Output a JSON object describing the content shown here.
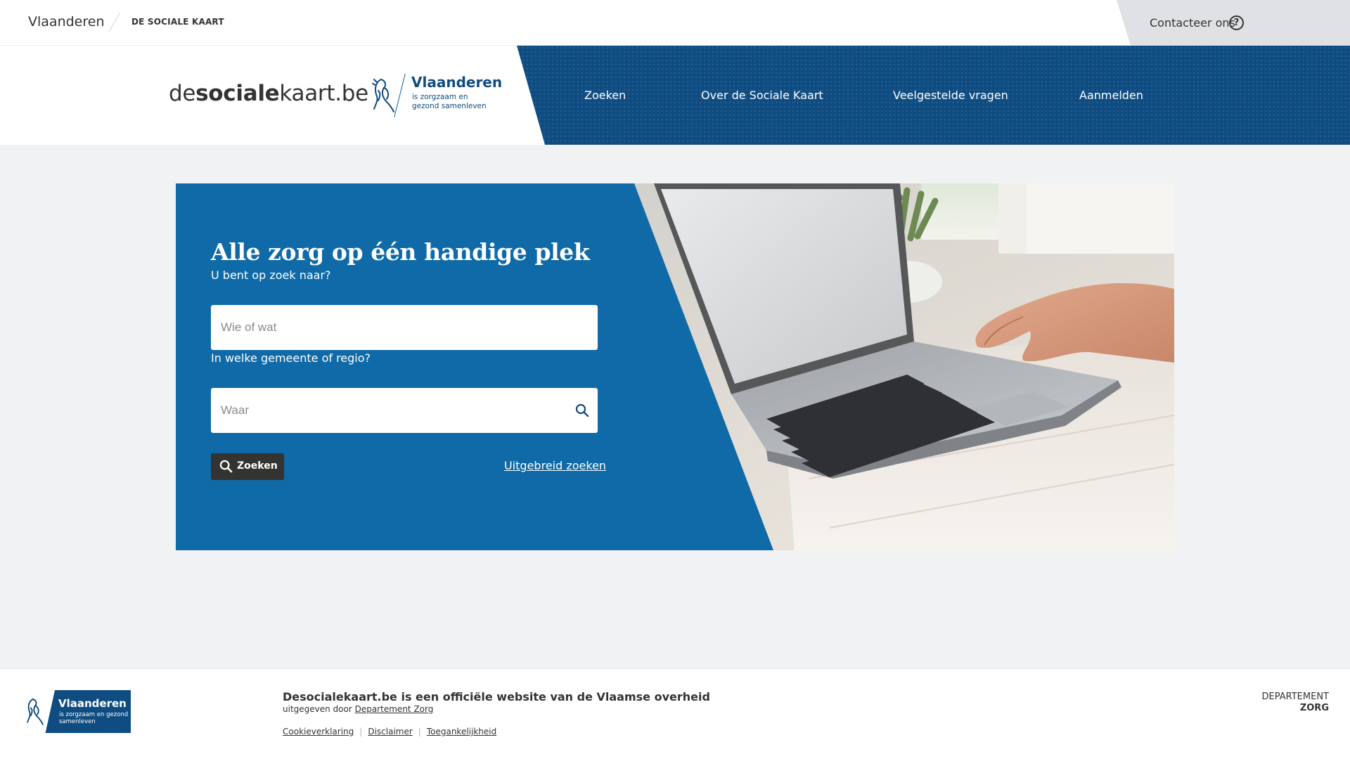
{
  "topbar": {
    "brand": "Vlaanderen",
    "site_name": "DE SOCIALE KAART",
    "contact_label": "Contacteer ons",
    "contact_icon": "question-circle-icon"
  },
  "header": {
    "logo_prefix": "de",
    "logo_bold": "sociale",
    "logo_suffix": "kaart.be",
    "vl_title": "Vlaanderen",
    "vl_subtitle": "is zorgzaam en gezond samenleven",
    "nav": [
      {
        "label": "Zoeken"
      },
      {
        "label": "Over de Sociale Kaart"
      },
      {
        "label": "Veelgestelde vragen"
      },
      {
        "label": "Aanmelden"
      }
    ]
  },
  "hero": {
    "title": "Alle zorg op één handige plek",
    "what_label": "U bent op zoek naar?",
    "what_placeholder": "Wie of wat",
    "where_label": "In welke gemeente of regio?",
    "where_placeholder": "Waar",
    "search_button": "Zoeken",
    "advanced_link": "Uitgebreid zoeken",
    "colors": {
      "panel": "#0f6aa7",
      "button": "#333332"
    }
  },
  "footer": {
    "logo_title": "Vlaanderen",
    "logo_subtitle": "is zorgzaam en gezond samenleven",
    "title": "Desocialekaart.be is een officiële website van de Vlaamse overheid",
    "published_by": "uitgegeven door",
    "publisher": "Departement Zorg",
    "links": [
      "Cookieverklaring",
      "Disclaimer",
      "Toegankelijkheid"
    ],
    "dept_line1": "DEPARTEMENT",
    "dept_line2": "ZORG"
  }
}
